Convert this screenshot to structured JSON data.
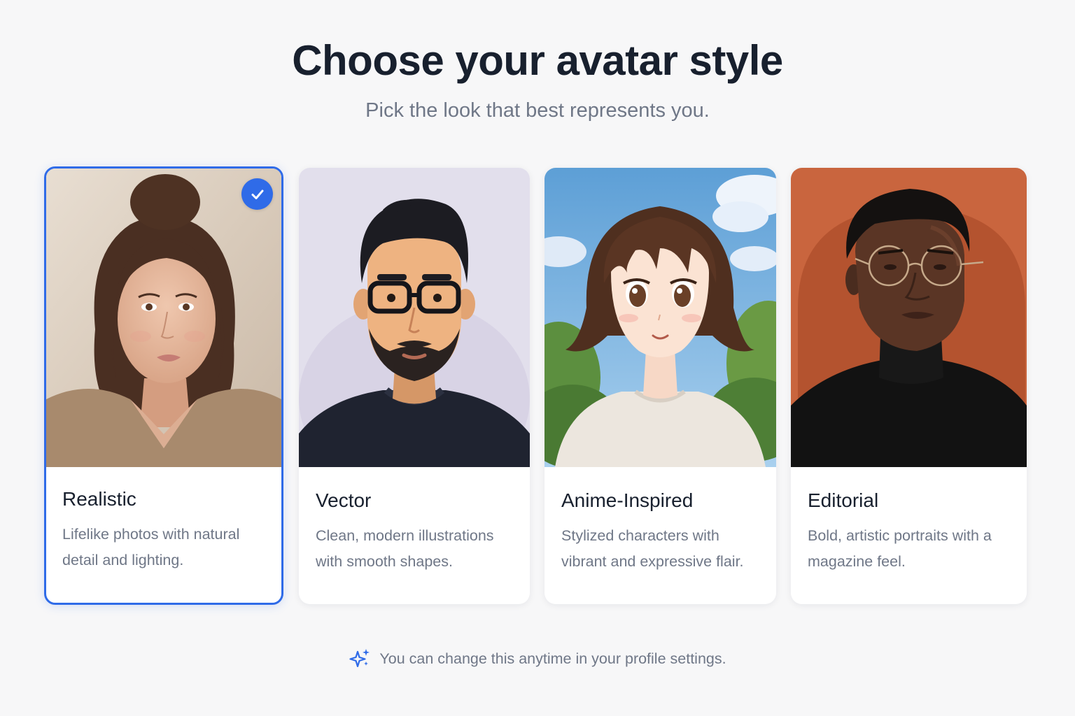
{
  "header": {
    "title": "Choose your avatar style",
    "subtitle": "Pick the look that best represents you."
  },
  "styles": [
    {
      "name": "Realistic",
      "description": "Lifelike photos with natural detail and lighting.",
      "selected": true,
      "portrait": "woman-with-hair-bun-photo"
    },
    {
      "name": "Vector",
      "description": "Clean, modern illustrations with smooth shapes.",
      "selected": false,
      "portrait": "bearded-man-with-glasses-illustration"
    },
    {
      "name": "Anime-Inspired",
      "description": "Stylized characters with vibrant and expressive flair.",
      "selected": false,
      "portrait": "anime-girl-with-bob-hair"
    },
    {
      "name": "Editorial",
      "description": "Bold, artistic portraits with a magazine feel.",
      "selected": false,
      "portrait": "man-in-turtleneck-with-round-glasses"
    }
  ],
  "footer": {
    "note": "You can change this anytime in your profile settings.",
    "icon": "sparkle-icon"
  },
  "colors": {
    "accent": "#2f6be8",
    "title": "#18202e",
    "muted": "#6f7787",
    "background": "#f7f7f8"
  }
}
